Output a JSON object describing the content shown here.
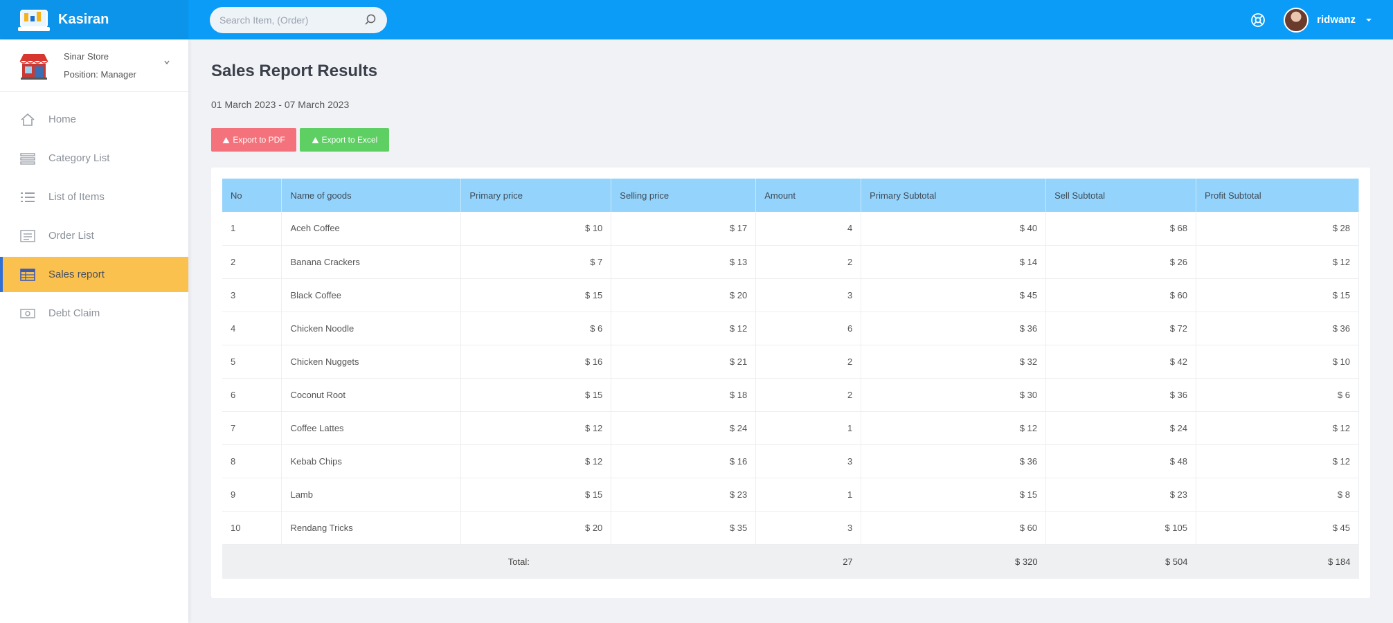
{
  "brand": {
    "name": "Kasiran"
  },
  "search": {
    "placeholder": "Search Item, (Order)"
  },
  "user": {
    "name": "ridwanz"
  },
  "store": {
    "line1": "Sinar Store",
    "line2": "Position: Manager"
  },
  "sidebar": {
    "items": [
      {
        "label": "Home",
        "icon": "home-icon"
      },
      {
        "label": "Category List",
        "icon": "list-icon"
      },
      {
        "label": "List of Items",
        "icon": "list-icon"
      },
      {
        "label": "Order List",
        "icon": "list-icon"
      },
      {
        "label": "Sales report",
        "icon": "table-icon",
        "active": true
      },
      {
        "label": "Debt Claim",
        "icon": "money-icon"
      }
    ]
  },
  "page": {
    "title": "Sales Report Results",
    "date_range": "01 March 2023 - 07 March 2023",
    "export_pdf": "Export to PDF",
    "export_excel": "Export to Excel"
  },
  "table": {
    "headers": [
      "No",
      "Name of goods",
      "Primary price",
      "Selling price",
      "Amount",
      "Primary Subtotal",
      "Sell Subtotal",
      "Profit Subtotal"
    ],
    "rows": [
      [
        "1",
        "Aceh Coffee",
        "$ 10",
        "$ 17",
        "4",
        "$ 40",
        "$ 68",
        "$ 28"
      ],
      [
        "2",
        "Banana Crackers",
        "$ 7",
        "$ 13",
        "2",
        "$ 14",
        "$ 26",
        "$ 12"
      ],
      [
        "3",
        "Black Coffee",
        "$ 15",
        "$ 20",
        "3",
        "$ 45",
        "$ 60",
        "$ 15"
      ],
      [
        "4",
        "Chicken Noodle",
        "$ 6",
        "$ 12",
        "6",
        "$ 36",
        "$ 72",
        "$ 36"
      ],
      [
        "5",
        "Chicken Nuggets",
        "$ 16",
        "$ 21",
        "2",
        "$ 32",
        "$ 42",
        "$ 10"
      ],
      [
        "6",
        "Coconut Root",
        "$ 15",
        "$ 18",
        "2",
        "$ 30",
        "$ 36",
        "$ 6"
      ],
      [
        "7",
        "Coffee Lattes",
        "$ 12",
        "$ 24",
        "1",
        "$ 12",
        "$ 24",
        "$ 12"
      ],
      [
        "8",
        "Kebab Chips",
        "$ 12",
        "$ 16",
        "3",
        "$ 36",
        "$ 48",
        "$ 12"
      ],
      [
        "9",
        "Lamb",
        "$ 15",
        "$ 23",
        "1",
        "$ 15",
        "$ 23",
        "$ 8"
      ],
      [
        "10",
        "Rendang Tricks",
        "$ 20",
        "$ 35",
        "3",
        "$ 60",
        "$ 105",
        "$ 45"
      ]
    ],
    "footer": {
      "label": "Total:",
      "amount": "27",
      "primary_subtotal": "$ 320",
      "sell_subtotal": "$ 504",
      "profit_subtotal": "$ 184"
    }
  }
}
